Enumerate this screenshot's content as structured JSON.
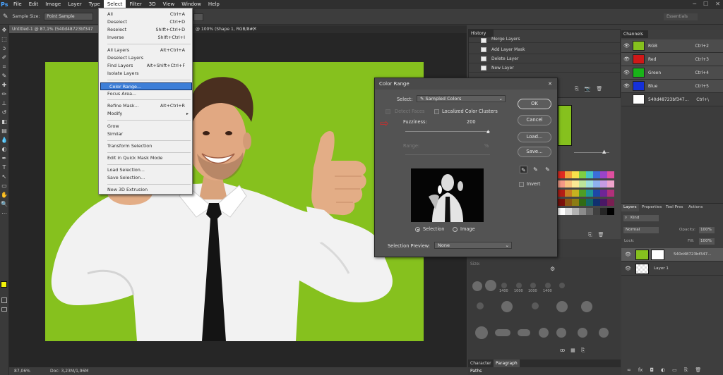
{
  "menubar": {
    "logo": "Ps",
    "items": [
      "File",
      "Edit",
      "Image",
      "Layer",
      "Type",
      "Select",
      "Filter",
      "3D",
      "View",
      "Window",
      "Help"
    ],
    "active": "Select"
  },
  "options": {
    "sample_size_label": "Sample Size:",
    "sample_size_value": "Point Sample",
    "workspace": "Essentials"
  },
  "document": {
    "tab_active": "Untitled-1 @ 87,1% (540d48723bf347",
    "tab_other": "@ 100% (Shape 1, RGB/8#)",
    "zoom": "87,06%",
    "doc_info": "Doc: 3,23M/1,96M"
  },
  "select_menu": {
    "items": [
      {
        "label": "All",
        "shortcut": "Ctrl+A"
      },
      {
        "label": "Deselect",
        "shortcut": "Ctrl+D"
      },
      {
        "label": "Reselect",
        "shortcut": "Shift+Ctrl+D"
      },
      {
        "label": "Inverse",
        "shortcut": "Shift+Ctrl+I"
      },
      {
        "label": "All Layers",
        "shortcut": "Alt+Ctrl+A"
      },
      {
        "label": "Deselect Layers",
        "shortcut": ""
      },
      {
        "label": "Find Layers",
        "shortcut": "Alt+Shift+Ctrl+F"
      },
      {
        "label": "Isolate Layers",
        "shortcut": ""
      },
      {
        "label": "Color Range...",
        "shortcut": ""
      },
      {
        "label": "Focus Area...",
        "shortcut": ""
      },
      {
        "label": "Refine Mask...",
        "shortcut": "Alt+Ctrl+R"
      },
      {
        "label": "Modify",
        "shortcut": ""
      },
      {
        "label": "Grow",
        "shortcut": ""
      },
      {
        "label": "Similar",
        "shortcut": ""
      },
      {
        "label": "Transform Selection",
        "shortcut": ""
      },
      {
        "label": "Edit in Quick Mask Mode",
        "shortcut": ""
      },
      {
        "label": "Load Selection...",
        "shortcut": ""
      },
      {
        "label": "Save Selection...",
        "shortcut": ""
      },
      {
        "label": "New 3D Extrusion",
        "shortcut": ""
      }
    ]
  },
  "color_range": {
    "title": "Color Range",
    "select_label": "Select:",
    "select_value": "Sampled Colors",
    "detect_faces": "Detect Faces",
    "localized": "Localized Color Clusters",
    "fuzziness_label": "Fuzziness:",
    "fuzziness_value": "200",
    "range_label": "Range:",
    "range_pct": "%",
    "radio_selection": "Selection",
    "radio_image": "Image",
    "preview_label": "Selection Preview:",
    "preview_value": "None",
    "ok": "OK",
    "cancel": "Cancel",
    "load": "Load...",
    "save": "Save...",
    "invert": "Invert"
  },
  "history": {
    "title": "History",
    "rows": [
      "Merge Layers",
      "Add Layer Mask",
      "Delete Layer",
      "New Layer"
    ]
  },
  "channels": {
    "title": "Channels",
    "rows": [
      {
        "name": "RGB",
        "shortcut": "Ctrl+2",
        "color": "#86c11e"
      },
      {
        "name": "Red",
        "shortcut": "Ctrl+3",
        "color": "#d01818"
      },
      {
        "name": "Green",
        "shortcut": "Ctrl+4",
        "color": "#19b319"
      },
      {
        "name": "Blue",
        "shortcut": "Ctrl+5",
        "color": "#1530d8"
      },
      {
        "name": "540d48723bf347...",
        "shortcut": "Ctrl+\\",
        "color": "#ffffff"
      }
    ]
  },
  "layers": {
    "tabs": [
      "Layers",
      "Properties",
      "Tool Pres",
      "Actions"
    ],
    "kind": "Kind",
    "mode": "Normal",
    "opacity_label": "Opacity:",
    "opacity": "100%",
    "lock_label": "Lock:",
    "fill_label": "Fill:",
    "fill": "100%",
    "rows": [
      "540d48723bf347...",
      "Layer 1"
    ]
  },
  "bottom_tabs": {
    "character": "Character",
    "paragraph": "Paragraph",
    "paths": "Paths"
  },
  "brush_panel": {
    "size_label": "Size:",
    "sizes": [
      "1400",
      "1000",
      "1000",
      "1400"
    ]
  }
}
